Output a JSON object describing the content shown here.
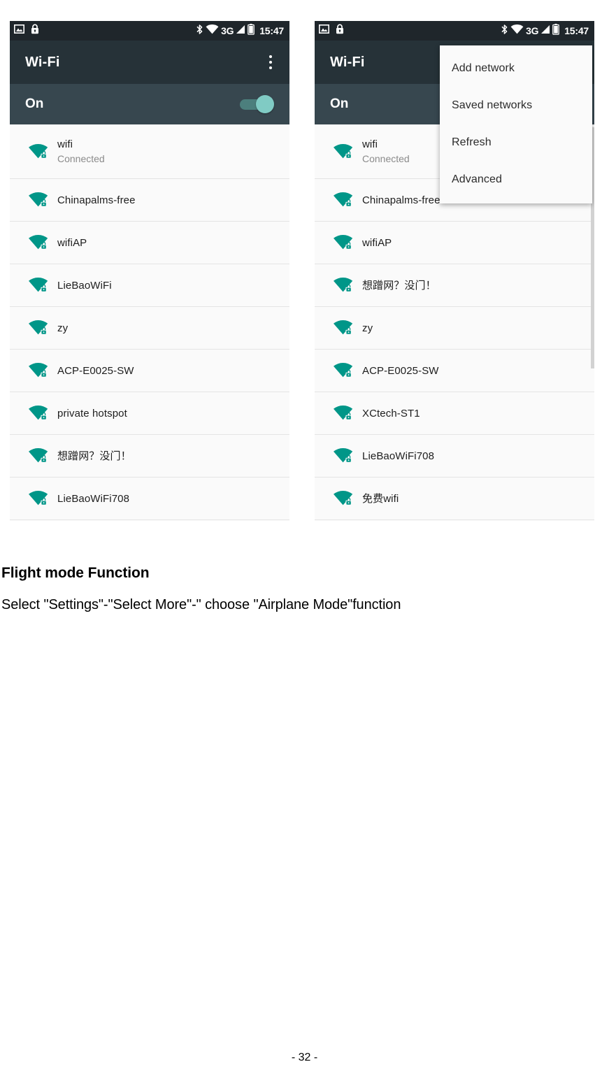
{
  "document": {
    "heading": "Flight mode Function",
    "paragraph": "Select \"Settings\"-\"Select More\"-\" choose \"Airplane Mode\"function",
    "page_number": "- 32 -"
  },
  "colors": {
    "statusbar_bg": "#1f262b",
    "appbar_bg": "#263238",
    "onband_bg": "#37474f",
    "wifi_teal": "#009688",
    "switch_thumb": "#80cbc4",
    "switch_track": "#4c7f7d",
    "list_bg": "#fafafa",
    "menu_bg": "#fafafa"
  },
  "statusbar": {
    "icons": [
      "image-icon",
      "lock-icon",
      "bluetooth-icon",
      "wifi-icon",
      "signal-icon",
      "battery-icon"
    ],
    "network_type": "3G",
    "time": "15:47"
  },
  "appbar": {
    "title": "Wi-Fi",
    "overflow_icon": "overflow-menu-icon"
  },
  "toggle": {
    "label": "On",
    "state": "on"
  },
  "left_screen": {
    "networks": [
      {
        "ssid": "wifi",
        "status": "Connected",
        "secured": true
      },
      {
        "ssid": "Chinapalms-free",
        "status": "",
        "secured": true
      },
      {
        "ssid": "wifiAP",
        "status": "",
        "secured": true
      },
      {
        "ssid": "LieBaoWiFi",
        "status": "",
        "secured": true
      },
      {
        "ssid": "zy",
        "status": "",
        "secured": true
      },
      {
        "ssid": "ACP-E0025-SW",
        "status": "",
        "secured": true
      },
      {
        "ssid": "private hotspot",
        "status": "",
        "secured": true
      },
      {
        "ssid": "想蹭网？没门！",
        "status": "",
        "secured": true
      },
      {
        "ssid": "LieBaoWiFi708",
        "status": "",
        "secured": true
      }
    ]
  },
  "right_screen": {
    "networks": [
      {
        "ssid": "wifi",
        "status": "Connected",
        "secured": true
      },
      {
        "ssid": "Chinapalms-free",
        "status": "",
        "secured": true
      },
      {
        "ssid": "wifiAP",
        "status": "",
        "secured": true
      },
      {
        "ssid": "想蹭网？没门！",
        "status": "",
        "secured": true
      },
      {
        "ssid": "zy",
        "status": "",
        "secured": true
      },
      {
        "ssid": "ACP-E0025-SW",
        "status": "",
        "secured": true
      },
      {
        "ssid": "XCtech-ST1",
        "status": "",
        "secured": true
      },
      {
        "ssid": "LieBaoWiFi708",
        "status": "",
        "secured": true
      },
      {
        "ssid": "免费wifi",
        "status": "",
        "secured": true
      }
    ],
    "overflow_menu": {
      "items": [
        {
          "label": "Add network"
        },
        {
          "label": "Saved networks"
        },
        {
          "label": "Refresh"
        },
        {
          "label": "Advanced"
        }
      ]
    }
  }
}
